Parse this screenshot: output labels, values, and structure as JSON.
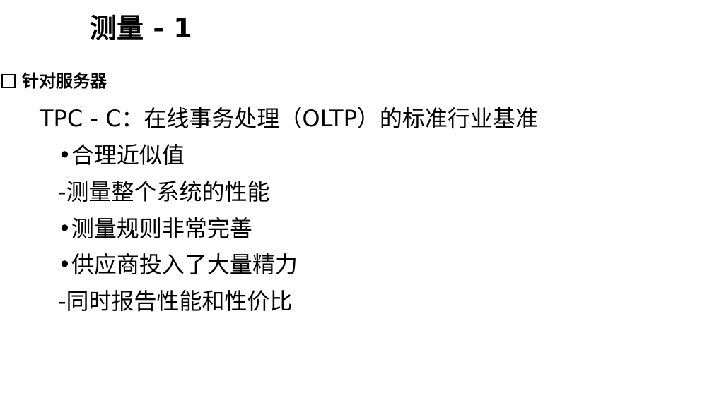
{
  "slide": {
    "title": "测量 - 1",
    "section": {
      "icon": "checkbox-icon",
      "heading": "针对服务器"
    },
    "lines": [
      "TPC - C：在线事务处理（OLTP）的标准行业基准",
      "•合理近似值",
      "-测量整个系统的性能",
      "•测量规则非常完善",
      "•供应商投入了大量精力",
      "-同时报告性能和性价比"
    ]
  }
}
